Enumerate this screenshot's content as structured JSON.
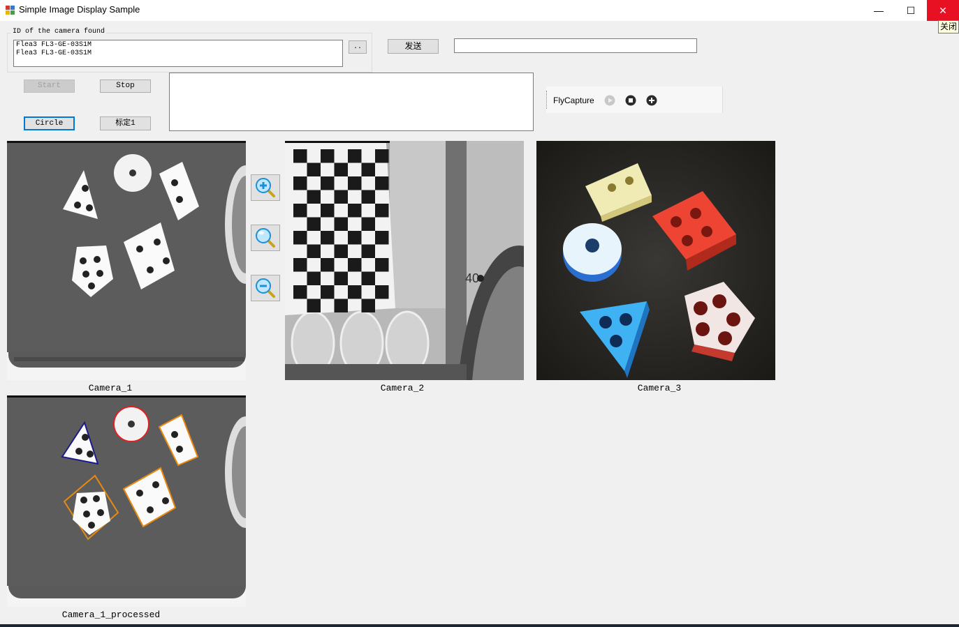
{
  "window": {
    "title": "Simple Image Display Sample",
    "minimize_glyph": "—",
    "maximize_glyph": "☐",
    "close_glyph": "✕",
    "close_tooltip": "关闭"
  },
  "camera_group": {
    "label": "ID of the camera found",
    "items": [
      "Flea3 FL3-GE-03S1M",
      "Flea3 FL3-GE-03S1M"
    ],
    "browse_label": ".."
  },
  "send": {
    "label": "发送",
    "value": ""
  },
  "controls": {
    "start_label": "Start",
    "stop_label": "Stop",
    "circle_label": "Circle",
    "calibrate_label": "标定1"
  },
  "log_text": "",
  "flycapture": {
    "label": "FlyCapture",
    "icons": [
      "play-icon",
      "stop-icon",
      "add-icon"
    ]
  },
  "zoom": {
    "icons": [
      "zoom-in-icon",
      "zoom-fit-icon",
      "zoom-out-icon"
    ]
  },
  "cameras": {
    "cam1_label": "Camera_1",
    "cam2_label": "Camera_2",
    "cam3_label": "Camera_3",
    "cam1_processed_label": "Camera_1_processed"
  },
  "colors": {
    "close_red": "#e81123",
    "focus_blue": "#0078d7",
    "detect_red": "#e02020",
    "detect_orange": "#e88a12",
    "detect_navy": "#1a1a8c",
    "piece_yellow": "#f2eeb0",
    "piece_red": "#ee4433",
    "piece_blue": "#3aa8f0"
  },
  "chess_label": "40"
}
